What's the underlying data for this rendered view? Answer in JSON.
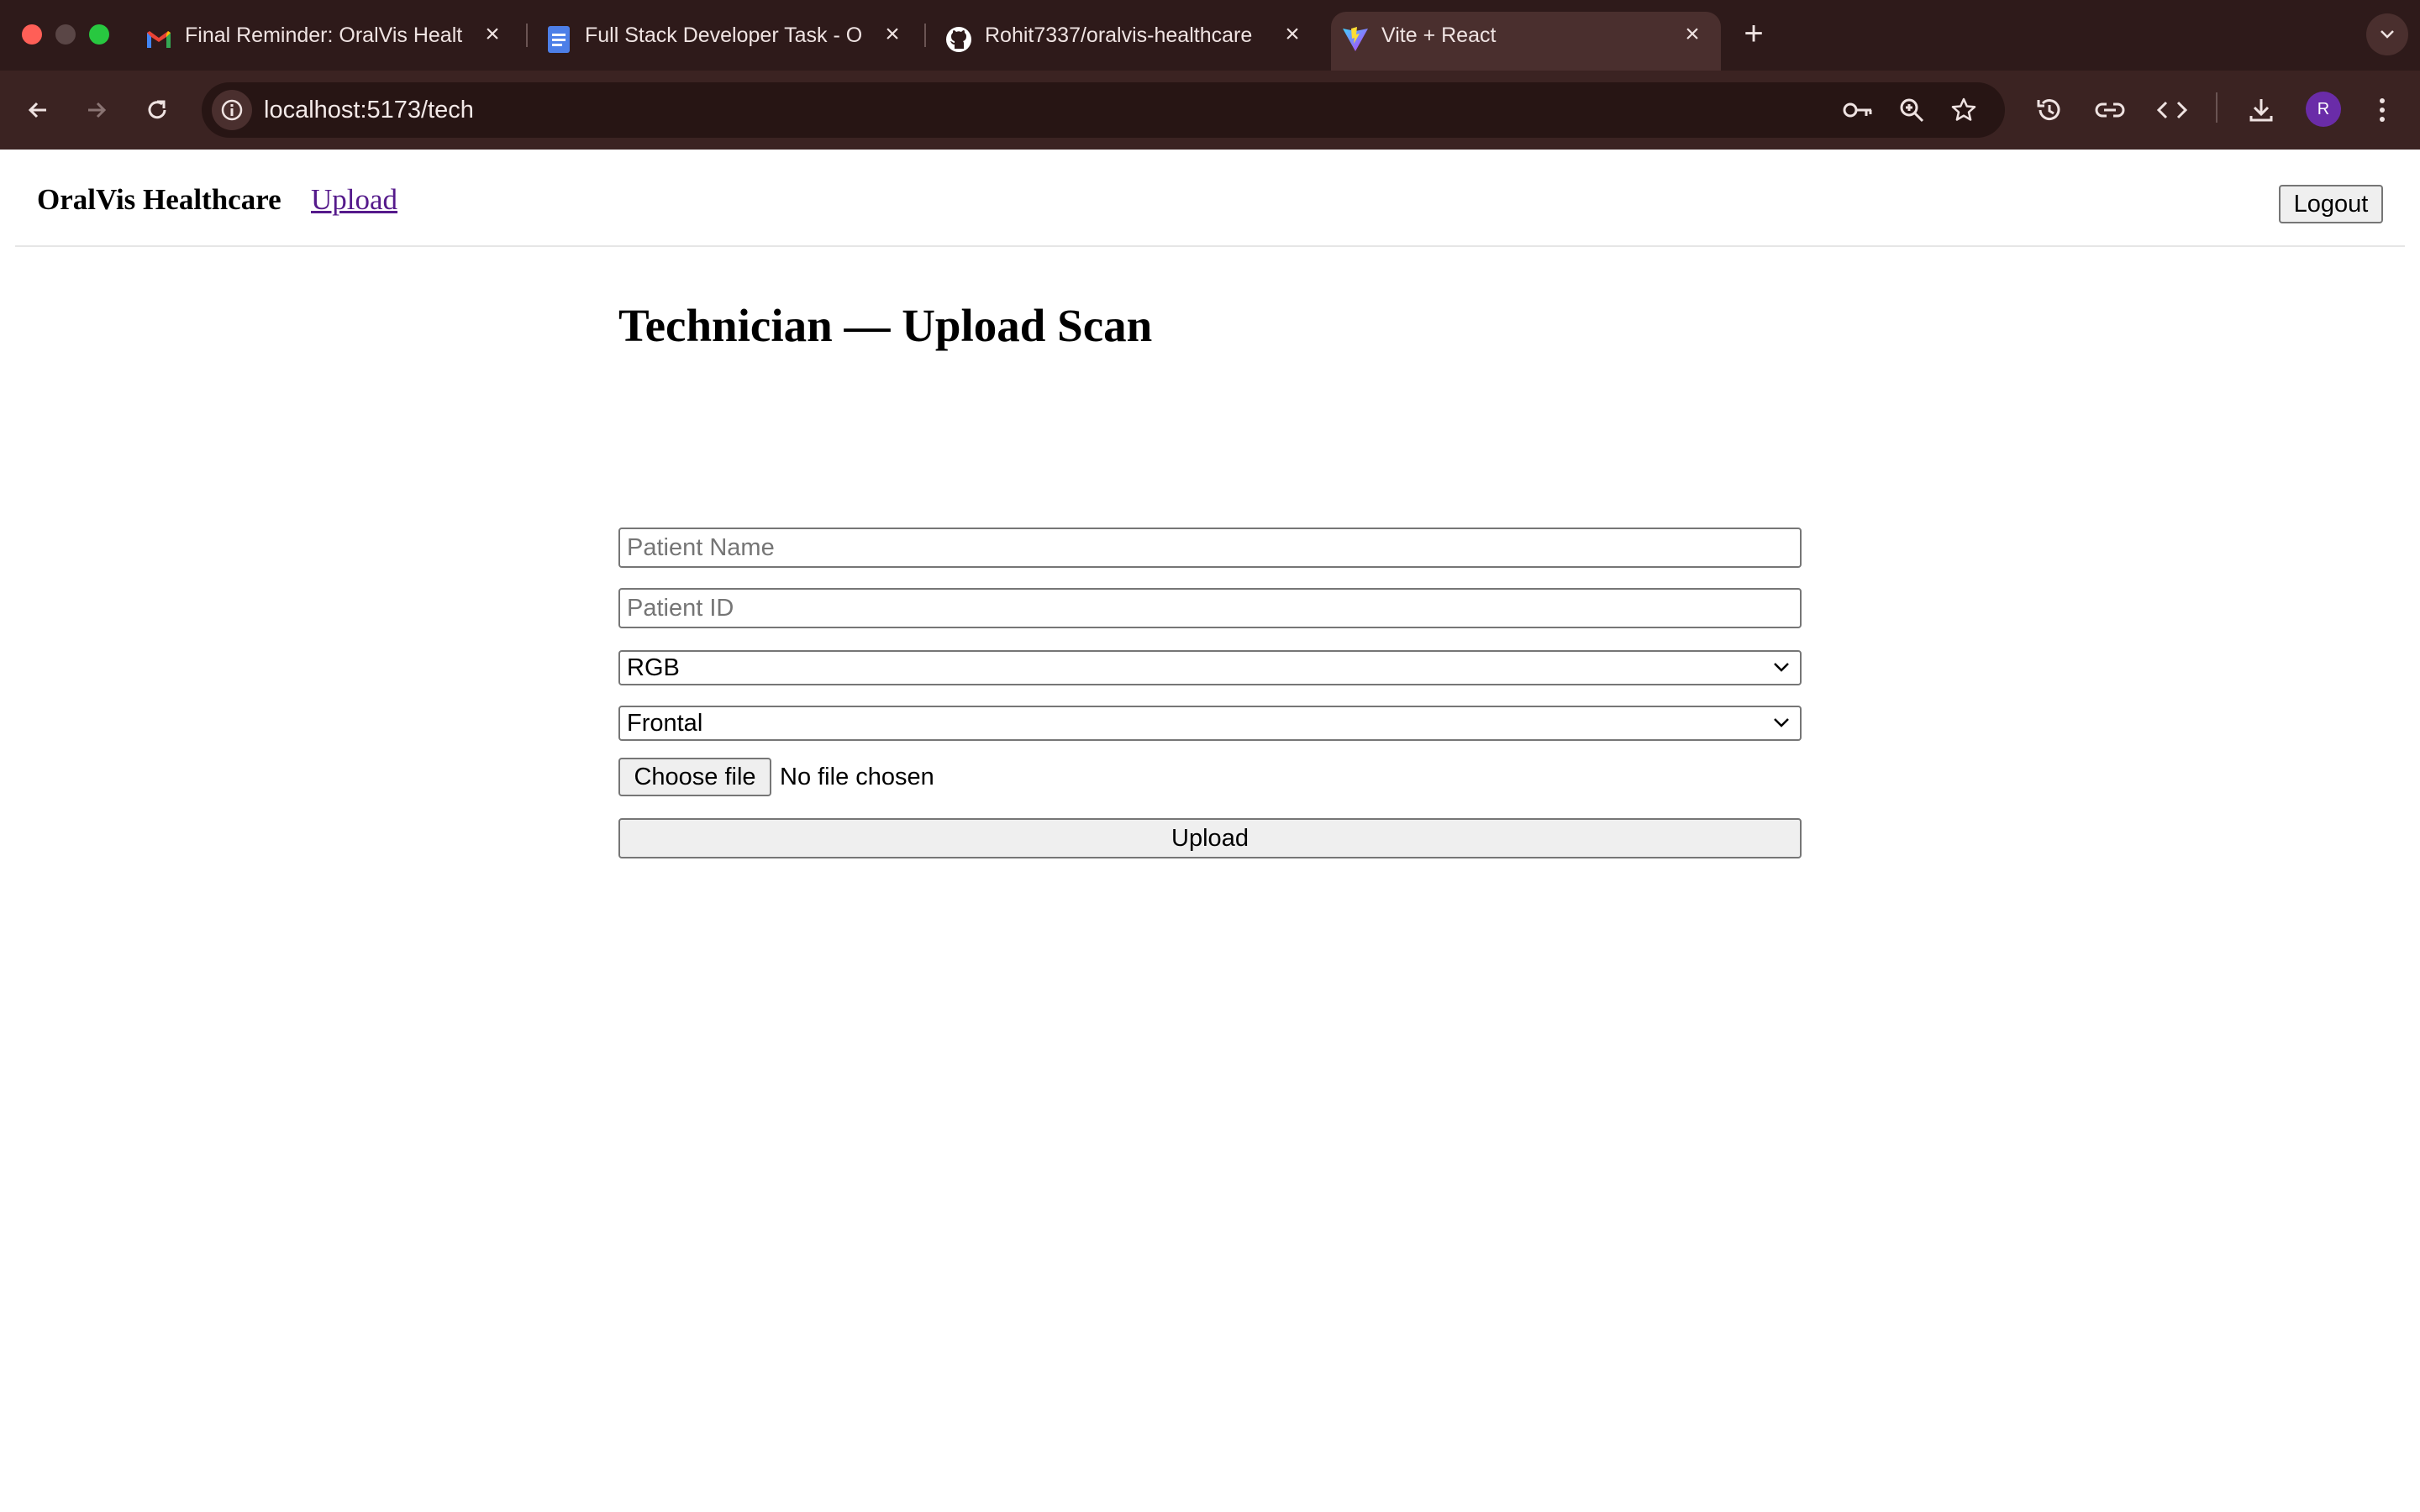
{
  "browser": {
    "tabs": [
      {
        "title": "Final Reminder: OralVis Healt",
        "favicon": "gmail-icon",
        "active": false
      },
      {
        "title": "Full Stack Developer Task - O",
        "favicon": "google-docs-icon",
        "active": false
      },
      {
        "title": "Rohit7337/oralvis-healthcare",
        "favicon": "github-icon",
        "active": false
      },
      {
        "title": "Vite + React",
        "favicon": "vite-icon",
        "active": true
      }
    ],
    "address": "localhost:5173/tech",
    "profile_initial": "R",
    "colors": {
      "tabbar": "#2e1a1a",
      "toolbar": "#3b2322",
      "profile": "#6a2ca8"
    }
  },
  "header": {
    "brand": "OralVis Healthcare",
    "nav_upload": "Upload",
    "logout": "Logout"
  },
  "form": {
    "title": "Technician — Upload Scan",
    "patient_name_placeholder": "Patient Name",
    "patient_id_placeholder": "Patient ID",
    "scan_type_selected": "RGB",
    "region_selected": "Frontal",
    "choose_file": "Choose file",
    "file_status": "No file chosen",
    "submit": "Upload"
  }
}
